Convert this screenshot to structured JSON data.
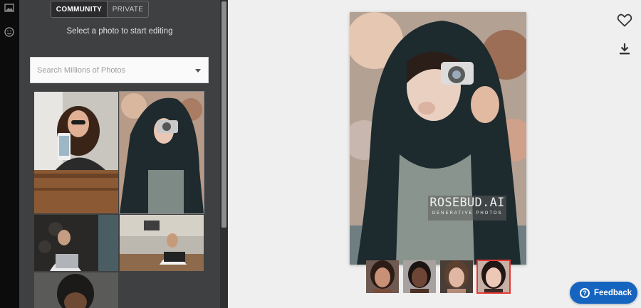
{
  "sidebar": {
    "icons": [
      "image-icon",
      "smiley-icon"
    ]
  },
  "gallery": {
    "tabs": [
      {
        "label": "COMMUNITY",
        "active": true
      },
      {
        "label": "PRIVATE",
        "active": false
      }
    ],
    "subtitle": "Select a photo to start editing",
    "search": {
      "placeholder": "Search Millions of Photos",
      "value": ""
    }
  },
  "editor": {
    "watermark": {
      "title": "ROSEBUD.AI",
      "subtitle": "GENERATIVE PHOTOS"
    },
    "face_options": [
      "face-option-1",
      "face-option-2",
      "face-option-3",
      "face-option-4"
    ],
    "selected_face": 4,
    "actions": [
      "heart-icon",
      "download-icon"
    ]
  },
  "feedback": {
    "label": "Feedback",
    "icon": "?"
  },
  "colors": {
    "accent": "#1565c0",
    "selection": "#e53935",
    "panel": "#3f4042"
  }
}
